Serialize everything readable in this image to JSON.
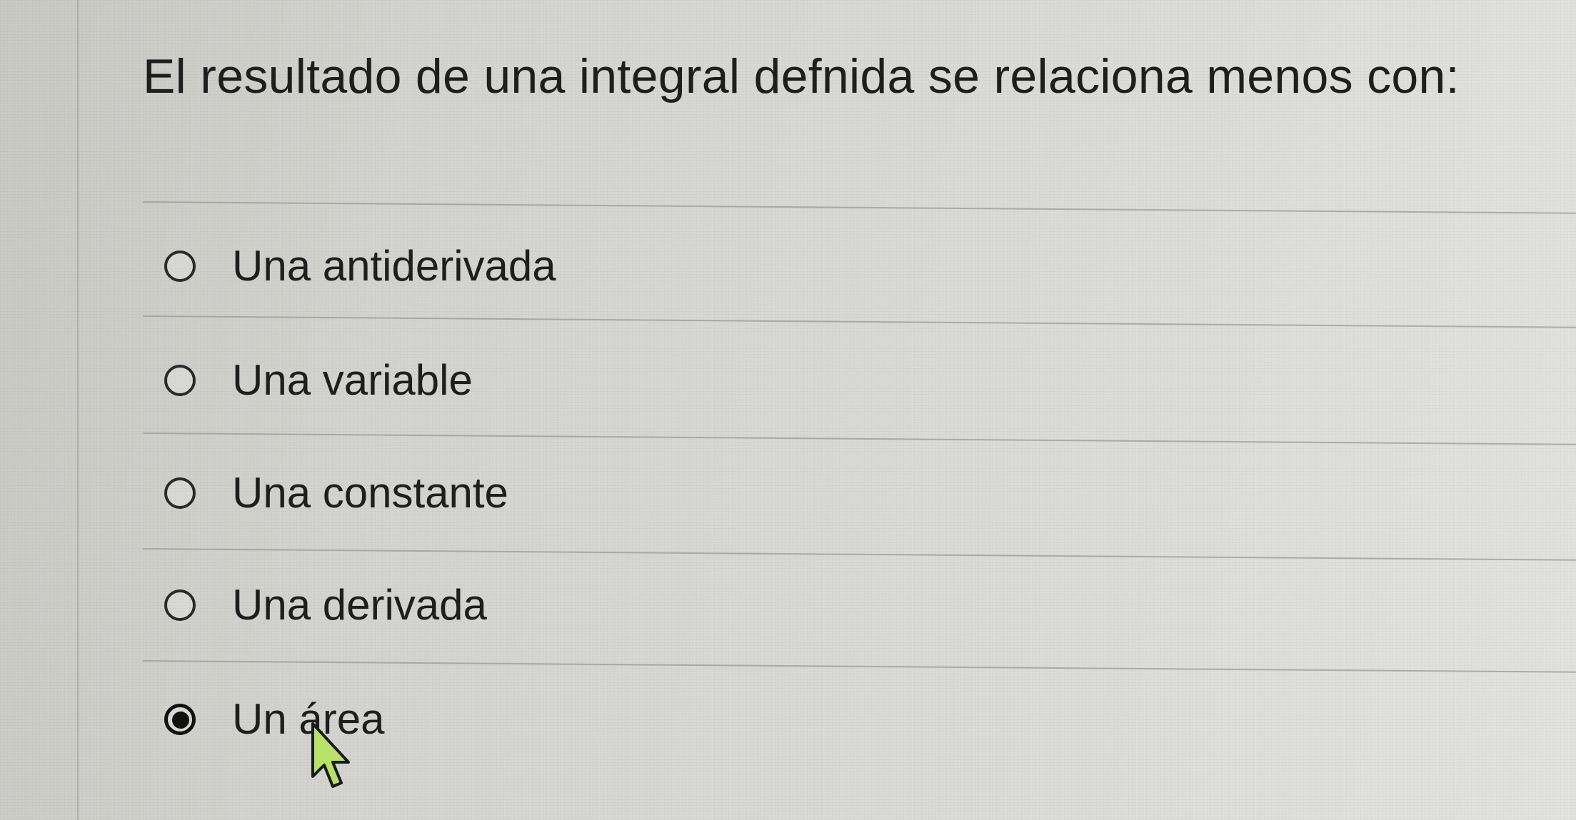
{
  "question": {
    "text": "El resultado de una integral defnida se relaciona menos con:"
  },
  "options": [
    {
      "label": "Una antiderivada",
      "selected": false
    },
    {
      "label": "Una variable",
      "selected": false
    },
    {
      "label": "Una constante",
      "selected": false
    },
    {
      "label": "Una derivada",
      "selected": false
    },
    {
      "label": "Un área",
      "selected": true
    }
  ],
  "icons": {
    "cursor": "mouse-pointer-icon"
  }
}
